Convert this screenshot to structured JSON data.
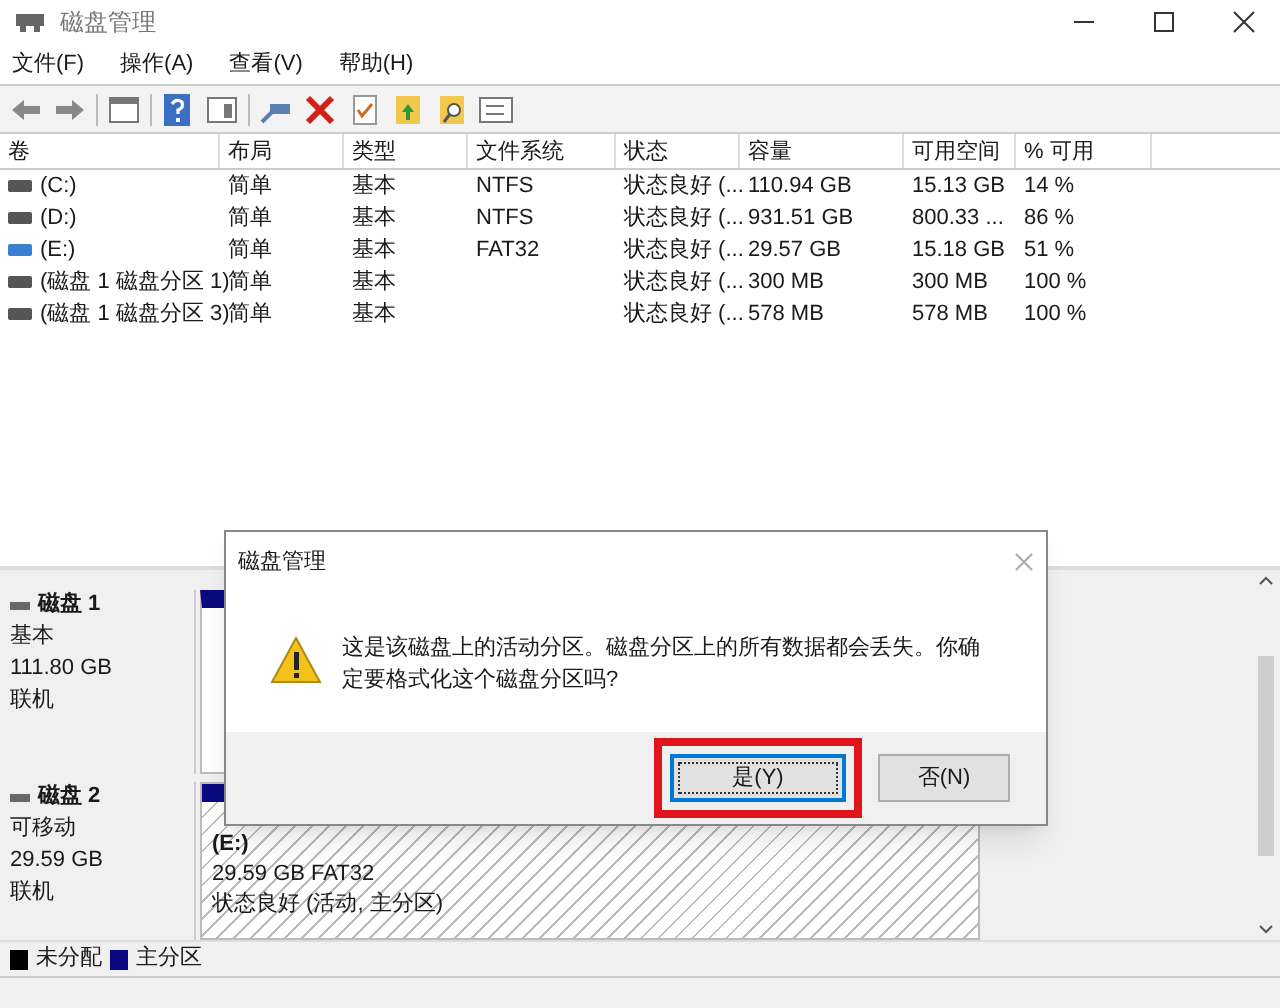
{
  "window": {
    "title": "磁盘管理"
  },
  "menu": [
    "文件(F)",
    "操作(A)",
    "查看(V)",
    "帮助(H)"
  ],
  "table": {
    "columns": [
      "卷",
      "布局",
      "类型",
      "文件系统",
      "状态",
      "容量",
      "可用空间",
      "% 可用"
    ],
    "rows": [
      {
        "kind": "fixed",
        "cells": [
          "(C:)",
          "简单",
          "基本",
          "NTFS",
          "状态良好 (...",
          "110.94 GB",
          "15.13 GB",
          "14 %"
        ]
      },
      {
        "kind": "fixed",
        "cells": [
          "(D:)",
          "简单",
          "基本",
          "NTFS",
          "状态良好 (...",
          "931.51 GB",
          "800.33 ...",
          "86 %"
        ]
      },
      {
        "kind": "removable",
        "cells": [
          "(E:)",
          "简单",
          "基本",
          "FAT32",
          "状态良好 (...",
          "29.57 GB",
          "15.18 GB",
          "51 %"
        ]
      },
      {
        "kind": "fixed",
        "cells": [
          "(磁盘 1 磁盘分区 1)",
          "简单",
          "基本",
          "",
          "状态良好 (...",
          "300 MB",
          "300 MB",
          "100 %"
        ]
      },
      {
        "kind": "fixed",
        "cells": [
          "(磁盘 1 磁盘分区 3)",
          "简单",
          "基本",
          "",
          "状态良好 (...",
          "578 MB",
          "578 MB",
          "100 %"
        ]
      }
    ]
  },
  "disks": [
    {
      "name": "磁盘 1",
      "type": "基本",
      "size": "111.80 GB",
      "status": "联机"
    },
    {
      "name": "磁盘 2",
      "type": "可移动",
      "size": "29.59 GB",
      "status": "联机",
      "partitions": [
        {
          "label": "(E:)",
          "size": "29.59 GB FAT32",
          "status": "状态良好 (活动, 主分区)",
          "color": "#0a0a80"
        }
      ]
    }
  ],
  "legend": [
    {
      "label": "未分配",
      "color": "#000000"
    },
    {
      "label": "主分区",
      "color": "#0a0a80"
    }
  ],
  "dialog": {
    "title": "磁盘管理",
    "message": "这是该磁盘上的活动分区。磁盘分区上的所有数据都会丢失。你确定要格式化这个磁盘分区吗?",
    "buttons": [
      {
        "label": "是(Y)",
        "selected": true
      },
      {
        "label": "否(N)",
        "selected": false
      }
    ]
  }
}
